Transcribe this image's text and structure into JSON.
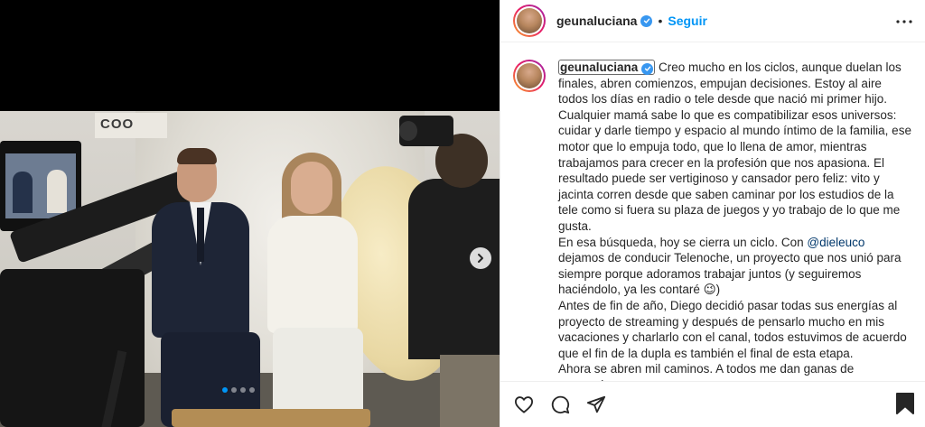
{
  "post": {
    "username": "geunaluciana",
    "follow_label": "Seguir",
    "separator": "•",
    "caption_paragraphs": [
      "Creo mucho en los ciclos, aunque duelan los finales, abren comienzos, empujan decisiones. Estoy al aire todos los días en radio o tele desde que nació mi primer hijo. Cualquier mamá sabe lo que es compatibilizar esos universos: cuidar y darle tiempo y espacio al mundo íntimo de la familia, ese motor que lo empuja todo, que lo llena de amor, mientras trabajamos para crecer en la profesión que nos apasiona. El resultado puede ser vertiginoso y cansador pero feliz: vito y jacinta corren desde que saben caminar por los estudios de la tele como si fuera su plaza de juegos y yo trabajo de lo que me gusta."
    ],
    "caption_p2_before": "En esa búsqueda, hoy se cierra un ciclo. Con ",
    "caption_p2_mention": "@dieleuco",
    "caption_p2_after": " dejamos de conducir Telenoche, un proyecto que nos unió para siempre porque adoramos trabajar juntos (y seguiremos haciéndolo, ya les contaré 😉)",
    "caption_p3": "Antes de fin de año, Diego decidió pasar todas sus energías al proyecto de streaming y después de pensarlo mucho en mis vacaciones y charlarlo con el canal, todos estuvimos de acuerdo que el fin de la dupla es también el final de esta etapa.",
    "caption_p4": "Ahora se abren mil caminos. A todos me dan ganas de recorrerlos",
    "photo_sign_text": "COO"
  },
  "carousel": {
    "count": 4,
    "active_index": 0
  },
  "colors": {
    "accent": "#0095f6",
    "mention": "#00376b",
    "verified": "#3897f0"
  },
  "icons": [
    "verified-icon",
    "more-options-icon",
    "like-icon",
    "comment-icon",
    "share-icon",
    "save-icon",
    "next-arrow-icon"
  ]
}
